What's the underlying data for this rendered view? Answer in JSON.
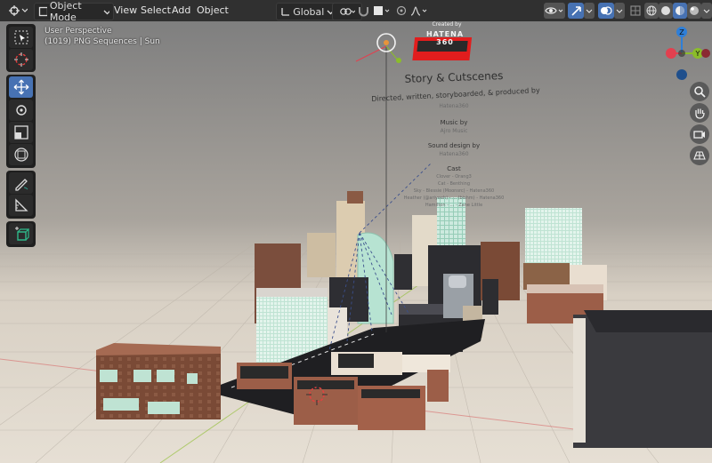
{
  "header": {
    "editor_icon": "editor-type-icon",
    "mode": "Object Mode",
    "menus": [
      "View",
      "Select",
      "Add",
      "Object"
    ],
    "transform_orientation": "Global"
  },
  "overlay": {
    "perspective": "User Perspective",
    "scene_info": "(1019) PNG Sequences | Sun"
  },
  "scene_text": {
    "created_by": "Created by",
    "logo": "HATENA 360",
    "title": "Story & Cutscenes",
    "line1": "Directed, written, storyboarded, & produced by",
    "line1_name": "Hatena360",
    "music_label": "Music by",
    "music_name": "Ajro Music",
    "sound_label": "Sound design by",
    "sound_name": "Hatena360",
    "cast_label": "Cast",
    "cast_lines": [
      "Clover - Orang3",
      "Cat - Benthing",
      "Sky - Blessie (Moonsrc) - Hatena360",
      "Heather (@ariyeeh) - ... (bishm) - Hatena360",
      "Hamilton - ... - Zane Little"
    ]
  },
  "gizmo": {
    "z": "Z",
    "y": "Y"
  },
  "colors": {
    "accent": "#4772b3",
    "axis_x": "#e2404f",
    "axis_y": "#8bbd2a",
    "axis_z": "#2f7fd8",
    "floor": "#dcd4c8"
  }
}
